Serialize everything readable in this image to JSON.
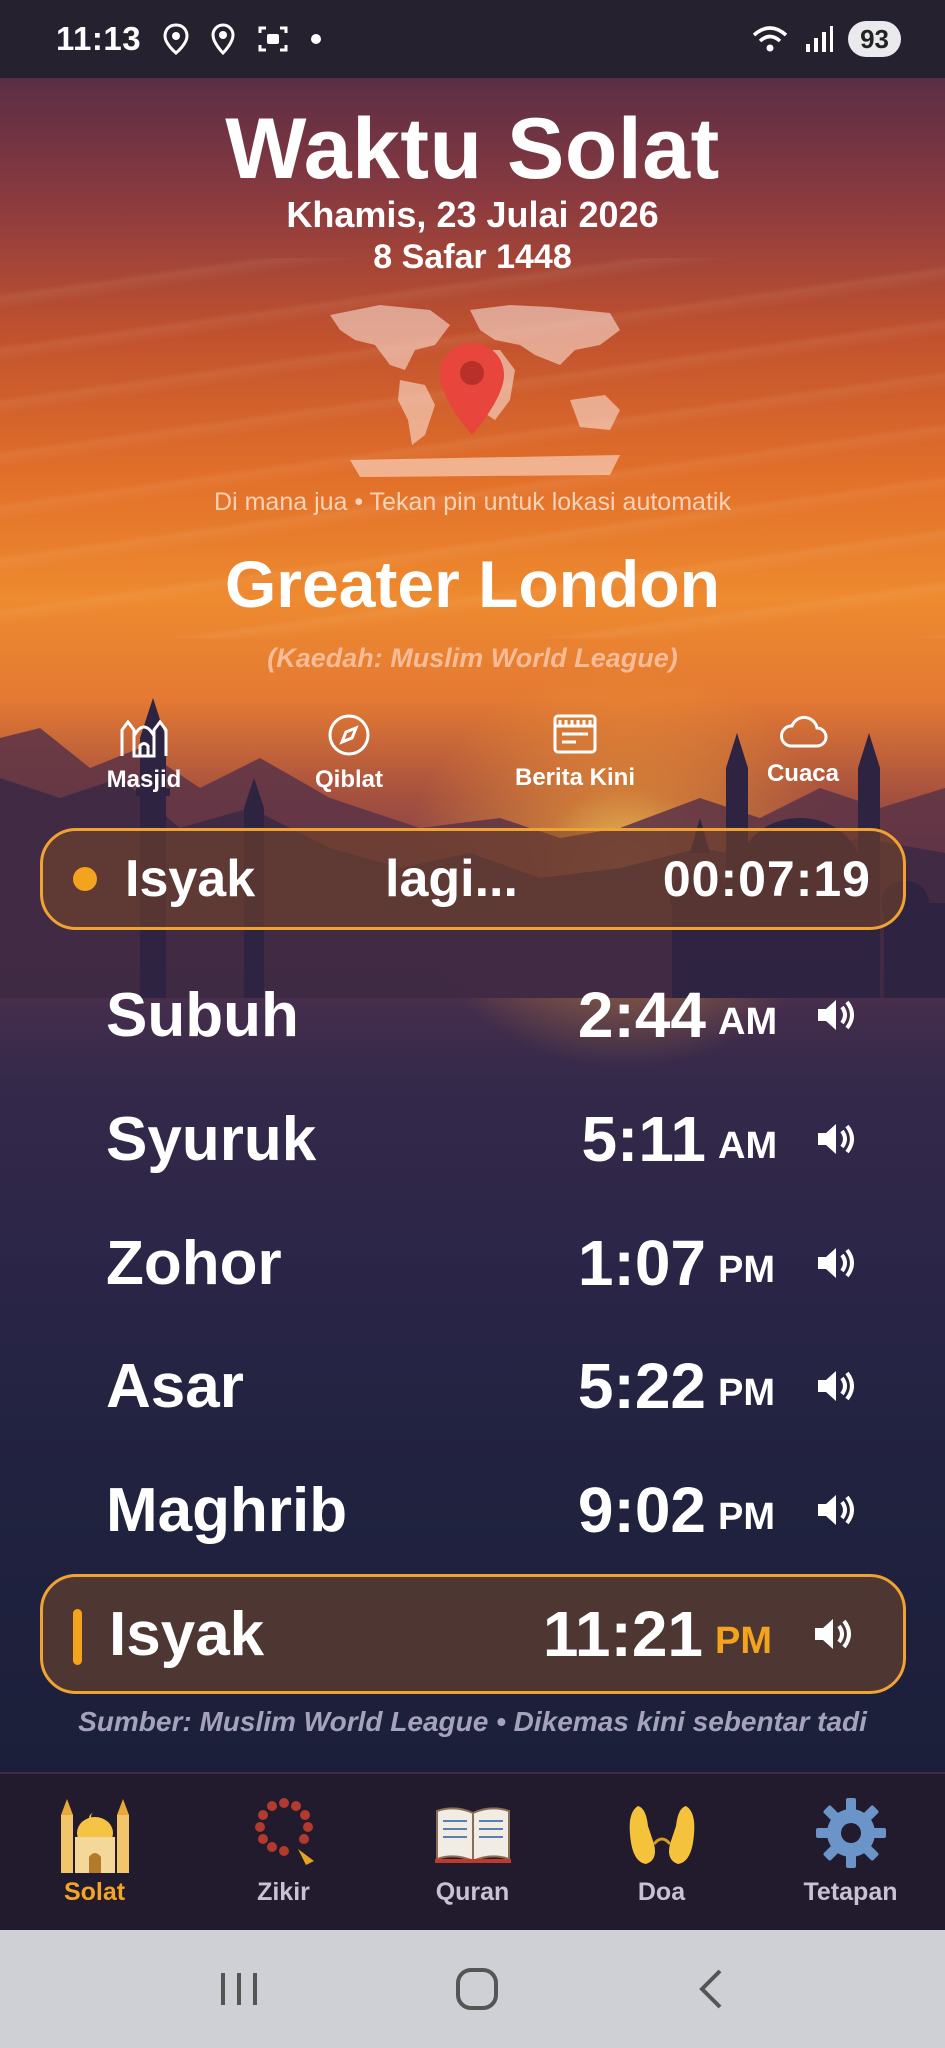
{
  "status_bar": {
    "time": "11:13",
    "battery": "93"
  },
  "header": {
    "title": "Waktu Solat",
    "date": "Khamis, 23 Julai 2026",
    "hijri": "8 Safar 1448",
    "hint": "Di mana jua • Tekan pin untuk lokasi automatik",
    "location": "Greater London",
    "method": "(Kaedah: Muslim World League)"
  },
  "quick_actions": [
    {
      "label": "Masjid",
      "icon": "mosque-icon"
    },
    {
      "label": "Qiblat",
      "icon": "compass-icon"
    },
    {
      "label": "Berita Kini",
      "icon": "news-icon"
    },
    {
      "label": "Cuaca",
      "icon": "cloud-icon"
    }
  ],
  "countdown": {
    "prayer": "Isyak",
    "label": "lagi...",
    "remaining": "00:07:19"
  },
  "prayers": [
    {
      "name": "Subuh",
      "time": "2:44",
      "period": "AM"
    },
    {
      "name": "Syuruk",
      "time": "5:11",
      "period": "AM"
    },
    {
      "name": "Zohor",
      "time": "1:07",
      "period": "PM"
    },
    {
      "name": "Asar",
      "time": "5:22",
      "period": "PM"
    },
    {
      "name": "Maghrib",
      "time": "9:02",
      "period": "PM"
    },
    {
      "name": "Isyak",
      "time": "11:21",
      "period": "PM",
      "active": true
    }
  ],
  "footer": {
    "source": "Sumber: Muslim World League • Dikemas kini sebentar tadi"
  },
  "bottom_nav": [
    {
      "label": "Solat",
      "icon": "mosque-icon",
      "active": true
    },
    {
      "label": "Zikir",
      "icon": "prayer-beads-icon"
    },
    {
      "label": "Quran",
      "icon": "book-icon"
    },
    {
      "label": "Doa",
      "icon": "praying-hands-icon"
    },
    {
      "label": "Tetapan",
      "icon": "gear-icon"
    }
  ],
  "colors": {
    "accent": "#f4a31f",
    "nav_bg": "#221a2d",
    "system_nav_bg": "#cfcfd6"
  }
}
